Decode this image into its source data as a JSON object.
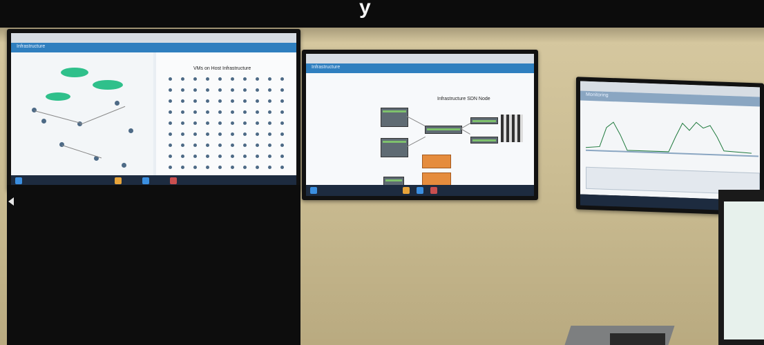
{
  "caption": {
    "text": "y"
  },
  "monitors": {
    "left": {
      "header": "Infrastructure",
      "panel_title": "VMs on Host Infrastructure"
    },
    "center": {
      "header": "Infrastructure",
      "canvas_title": "Infrastructure SDN Node"
    },
    "right": {
      "header": "Monitoring"
    }
  },
  "colors": {
    "header_blue": "#2f7fbf",
    "taskbar": "#1d2b3f",
    "wall": "#cdbf95",
    "monitor_bezel": "#111111",
    "cloud_green": "#2fc08b"
  }
}
